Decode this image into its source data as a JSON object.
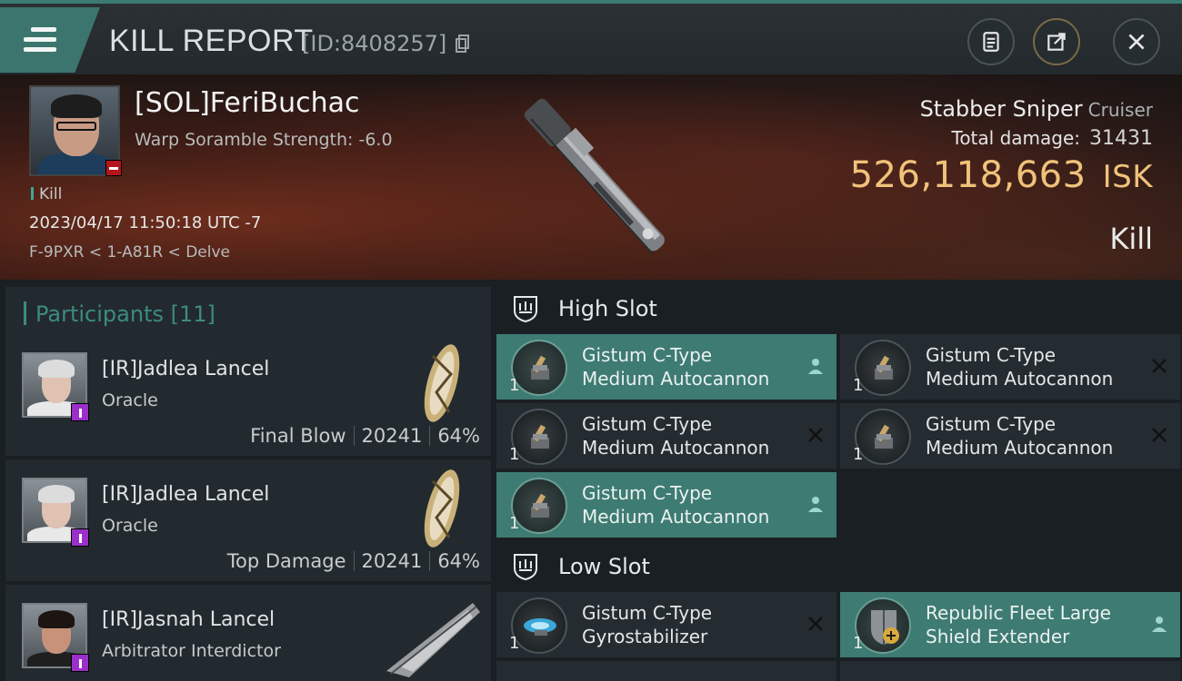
{
  "header": {
    "title": "KILL REPORT",
    "report_id": "[ID:8408257]"
  },
  "victim": {
    "name": "[SOL]FeriBuchac",
    "scramble": "Warp Soramble Strength: -6.0",
    "tag": "Kill",
    "datetime": "2023/04/17 11:50:18 UTC -7",
    "location": "F-9PXR < 1-A81R < Delve",
    "ship_name": "Stabber Sniper",
    "ship_class": "Cruiser",
    "total_damage_label": "Total damage:",
    "total_damage": "31431",
    "isk_value": "526,118,663",
    "isk_unit": "ISK",
    "result": "Kill"
  },
  "participants": {
    "label": "Participants [11]",
    "rows": [
      {
        "name": "[IR]Jadlea Lancel",
        "ship": "Oracle",
        "role": "Final Blow",
        "damage": "20241",
        "percent": "64%"
      },
      {
        "name": "[IR]Jadlea Lancel",
        "ship": "Oracle",
        "role": "Top Damage",
        "damage": "20241",
        "percent": "64%"
      },
      {
        "name": "[IR]Jasnah Lancel",
        "ship": "Arbitrator Interdictor",
        "role": "",
        "damage": "",
        "percent": ""
      }
    ]
  },
  "slots": {
    "high_label": "High Slot",
    "low_label": "Low Slot",
    "high": [
      {
        "line1": "Gistum C-Type",
        "line2": "Medium Autocannon",
        "qty": "1",
        "state": "fitted"
      },
      {
        "line1": "Gistum C-Type",
        "line2": "Medium Autocannon",
        "qty": "1",
        "state": "destroyed"
      },
      {
        "line1": "Gistum C-Type",
        "line2": "Medium Autocannon",
        "qty": "1",
        "state": "destroyed"
      },
      {
        "line1": "Gistum C-Type",
        "line2": "Medium Autocannon",
        "qty": "1",
        "state": "destroyed"
      },
      {
        "line1": "Gistum C-Type",
        "line2": "Medium Autocannon",
        "qty": "1",
        "state": "fitted"
      }
    ],
    "low": [
      {
        "line1": "Gistum C-Type",
        "line2": "Gyrostabilizer",
        "qty": "1",
        "state": "destroyed"
      },
      {
        "line1": "Republic Fleet Large",
        "line2": "Shield Extender",
        "qty": "1",
        "state": "fitted"
      }
    ]
  },
  "colors": {
    "accent": "#3e7b72",
    "isk": "#f0c27a",
    "badge_purple": "#9b2fc9",
    "badge_red": "#b3151b"
  }
}
